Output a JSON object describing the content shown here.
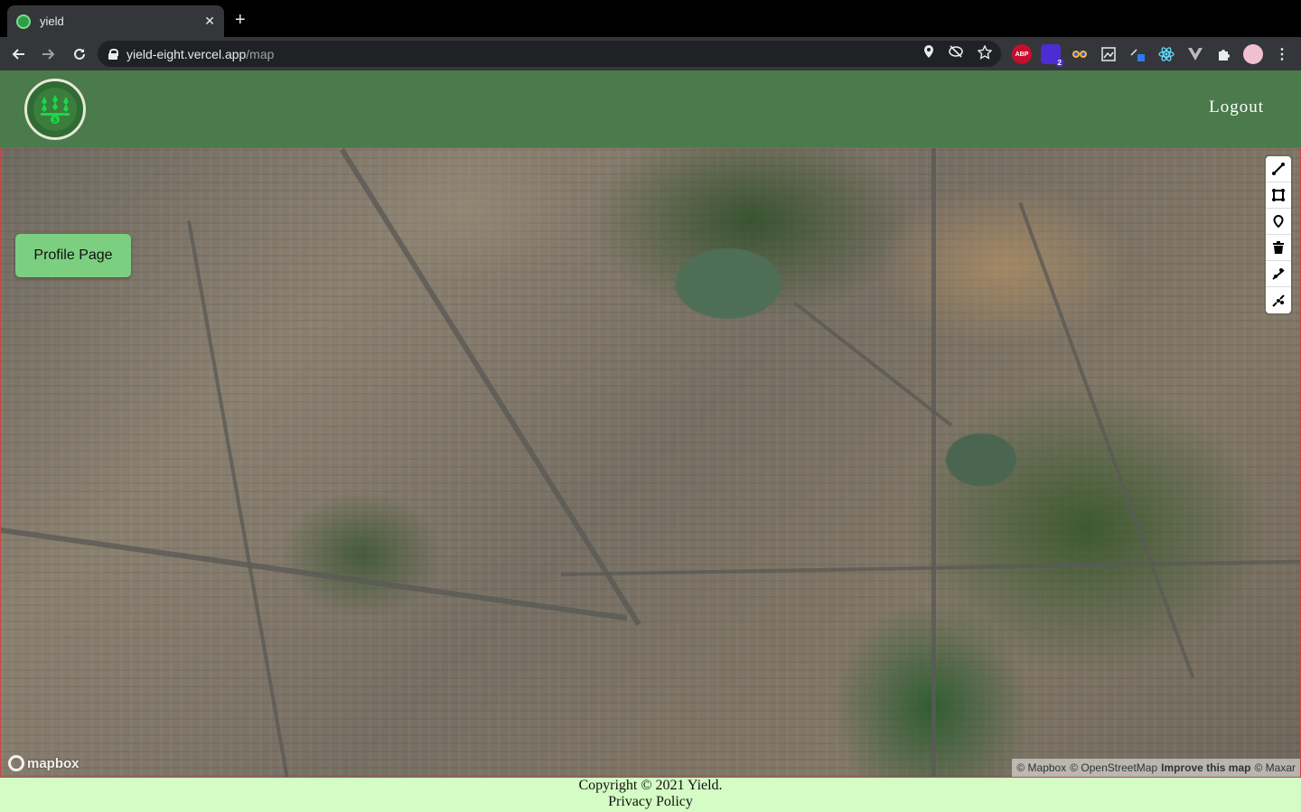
{
  "browser": {
    "tab_title": "yield",
    "tab_close": "✕",
    "new_tab": "+",
    "url_host": "yield-eight.vercel.app",
    "url_path": "/map",
    "ext_abp": "ABP",
    "ext_badge": "2"
  },
  "header": {
    "logout_label": "Logout"
  },
  "map": {
    "profile_button_label": "Profile Page",
    "mapbox_logo_text": "mapbox",
    "attribution": {
      "mapbox": "© Mapbox",
      "osm": "© OpenStreetMap",
      "improve": "Improve this map",
      "maxar": "© Maxar"
    },
    "draw_tools": [
      "line-tool-icon",
      "polygon-tool-icon",
      "point-tool-icon",
      "trash-icon",
      "combine-icon",
      "uncombine-icon"
    ]
  },
  "footer": {
    "copyright": "Copyright © 2021 Yield.",
    "privacy": "Privacy Policy"
  },
  "colors": {
    "header_bg": "#4b7a4c",
    "footer_bg": "#d4fcc4",
    "profile_button_bg": "#7ccf80"
  }
}
